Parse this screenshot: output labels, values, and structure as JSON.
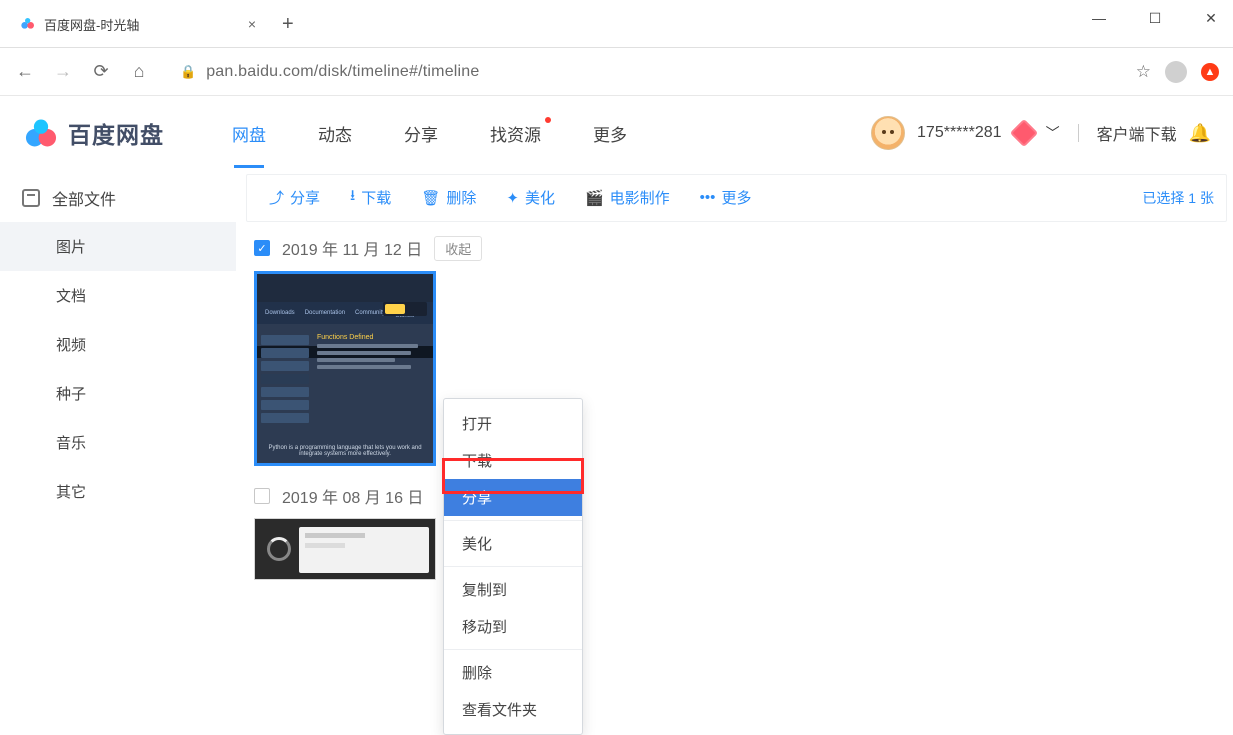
{
  "browser": {
    "tab_title": "百度网盘-时光轴",
    "url": "pan.baidu.com/disk/timeline#/timeline"
  },
  "header": {
    "logo_text": "百度网盘",
    "nav": [
      "网盘",
      "动态",
      "分享",
      "找资源",
      "更多"
    ],
    "active_nav_index": 0,
    "dot_nav_index": 3,
    "username": "175*****281",
    "client_download": "客户端下载"
  },
  "sidebar": {
    "all_files": "全部文件",
    "items": [
      "图片",
      "文档",
      "视频",
      "种子",
      "音乐",
      "其它"
    ],
    "active_index": 0
  },
  "toolbar": {
    "buttons": [
      {
        "icon": "share",
        "label": "分享"
      },
      {
        "icon": "download",
        "label": "下载"
      },
      {
        "icon": "trash",
        "label": "删除"
      },
      {
        "icon": "wand",
        "label": "美化"
      },
      {
        "icon": "film",
        "label": "电影制作"
      },
      {
        "icon": "dots",
        "label": "更多"
      }
    ],
    "selection_info": "已选择 1 张"
  },
  "timeline": {
    "groups": [
      {
        "date": "2019 年 11 月 12 日",
        "checked": true,
        "collapse_label": "收起"
      },
      {
        "date": "2019 年 08 月 16 日",
        "checked": false,
        "collapse_label": ""
      }
    ]
  },
  "thumb_preview": {
    "heading": "Functions Defined",
    "footer": "Python is a programming language that lets you work and integrate systems more effectively."
  },
  "context_menu": {
    "items": [
      "打开",
      "下载",
      "分享",
      "美化",
      "复制到",
      "移动到",
      "删除",
      "查看文件夹"
    ],
    "hover_index": 2,
    "separators_after": [
      2,
      3,
      5
    ]
  }
}
